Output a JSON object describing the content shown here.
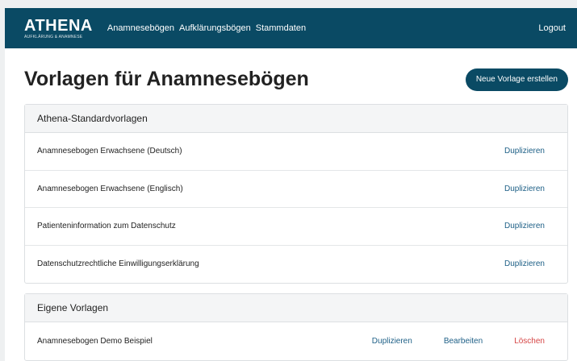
{
  "navbar": {
    "brand_name": "ATHENA",
    "brand_tagline": "AUFKLÄRUNG & ANAMNESE",
    "links": [
      "Anamnesebögen",
      "Aufklärungsbögen",
      "Stammdaten"
    ],
    "logout_label": "Logout",
    "bg_color": "#0a4a64"
  },
  "page": {
    "title": "Vorlagen für Anamnesebögen",
    "new_button_label": "Neue Vorlage erstellen"
  },
  "standard_section": {
    "header": "Athena-Standardvorlagen",
    "items": [
      {
        "label": "Anamnesebogen Erwachsene (Deutsch)",
        "action": "Duplizieren"
      },
      {
        "label": "Anamnesebogen Erwachsene (Englisch)",
        "action": "Duplizieren"
      },
      {
        "label": "Patienteninformation zum Datenschutz",
        "action": "Duplizieren"
      },
      {
        "label": "Datenschutzrechtliche Einwilligungserklärung",
        "action": "Duplizieren"
      }
    ]
  },
  "own_section": {
    "header": "Eigene Vorlagen",
    "items": [
      {
        "label": "Anamnesebogen Demo Beispiel",
        "duplicate": "Duplizieren",
        "edit": "Bearbeiten",
        "delete": "Löschen"
      }
    ]
  },
  "colors": {
    "link": "#1d5f86",
    "danger": "#d64545"
  }
}
